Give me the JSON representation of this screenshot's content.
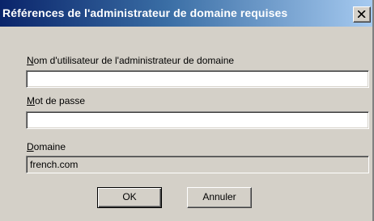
{
  "dialog": {
    "title": "Références de l'administrateur de domaine requises",
    "close_icon": "close-x-icon"
  },
  "fields": {
    "username": {
      "label_accel": "N",
      "label_rest": "om d'utilisateur de l'administrateur de domaine",
      "value": ""
    },
    "password": {
      "label_accel": "M",
      "label_rest": "ot de passe",
      "value": ""
    },
    "domain": {
      "label_accel": "D",
      "label_rest": "omaine",
      "value": "french.com"
    }
  },
  "buttons": {
    "ok": "OK",
    "cancel": "Annuler"
  }
}
